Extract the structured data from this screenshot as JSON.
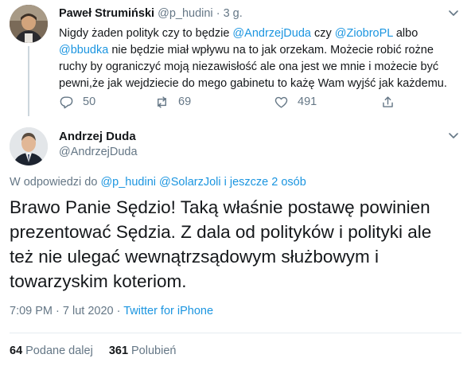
{
  "parent_tweet": {
    "name": "Paweł Strumiński",
    "handle": "@p_hudini",
    "separator": "·",
    "time": "3 g.",
    "lines": [
      [
        {
          "t": "Nigdy żaden polityk czy to będzie "
        },
        {
          "t": "@AndrzejDuda",
          "link": true
        },
        {
          "t": " czy "
        },
        {
          "t": "@ZiobroPL",
          "link": true
        },
        {
          "t": " albo"
        }
      ],
      [
        {
          "t": "@bbudka",
          "link": true
        },
        {
          "t": " nie będzie miał wpływu na to jak orzekam. Możecie robić rożne"
        }
      ],
      [
        {
          "t": "ruchy by ograniczyć moją niezawisłość ale ona jest we mnie i możecie być"
        }
      ],
      [
        {
          "t": "pewni,że jak wejdziecie do mego gabinetu to każę Wam wyjść jak każdemu."
        }
      ]
    ],
    "actions": {
      "reply_count": "50",
      "retweet_count": "69",
      "like_count": "491"
    }
  },
  "main_tweet": {
    "name": "Andrzej Duda",
    "handle": "@AndrzejDuda",
    "reply_prefix": "W odpowiedzi do ",
    "reply_users": "@p_hudini @SolarzJoli",
    "reply_suffix": " i jeszcze 2 osób",
    "lines": [
      "Brawo Panie Sędzio! Taką właśnie postawę powinien",
      "prezentować Sędzia. Z dala od polityków i polityki ale",
      "też nie ulegać wewnątrzsądowym służbowym i",
      "towarzyskim koteriom."
    ],
    "timestamp": "7:09 PM · 7 lut 2020 · ",
    "source": "Twitter for iPhone",
    "retweets_count": "64",
    "retweets_label": "Podane dalej",
    "likes_count": "361",
    "likes_label": "Polubień"
  },
  "colors": {
    "link": "#1b95e0",
    "secondary_text": "#657786",
    "primary_text": "#14171a",
    "thread_line": "#ccd6dd"
  },
  "icons": [
    "reply-icon",
    "retweet-icon",
    "like-icon",
    "share-icon",
    "chevron-down-icon"
  ]
}
